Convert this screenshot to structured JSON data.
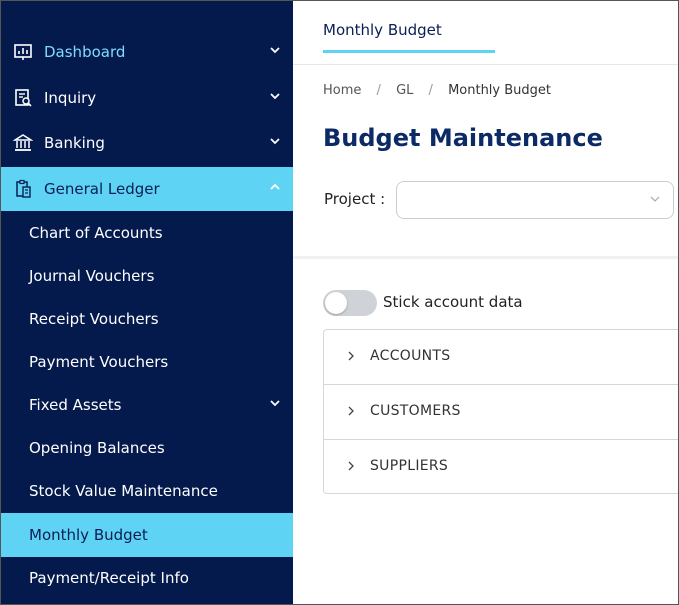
{
  "sidebar": {
    "items": [
      {
        "label": "Dashboard",
        "icon": "dashboard-chart-icon",
        "has_chevron": true
      },
      {
        "label": "Inquiry",
        "icon": "inquiry-search-icon",
        "has_chevron": true
      },
      {
        "label": "Banking",
        "icon": "bank-icon",
        "has_chevron": true
      },
      {
        "label": "General Ledger",
        "icon": "clipboard-ledger-icon",
        "expanded": true
      }
    ],
    "sub_items": [
      {
        "label": "Chart of Accounts"
      },
      {
        "label": "Journal Vouchers"
      },
      {
        "label": "Receipt Vouchers"
      },
      {
        "label": "Payment Vouchers"
      },
      {
        "label": "Fixed Assets",
        "has_chevron": true
      },
      {
        "label": "Opening Balances"
      },
      {
        "label": "Stock Value Maintenance"
      },
      {
        "label": "Monthly Budget",
        "active": true
      },
      {
        "label": "Payment/Receipt Info"
      }
    ]
  },
  "tabs": [
    {
      "label": "Monthly Budget"
    }
  ],
  "breadcrumb": {
    "home": "Home",
    "gl": "GL",
    "current": "Monthly Budget",
    "separator": "/"
  },
  "page": {
    "title": "Budget Maintenance"
  },
  "project": {
    "label": "Project :",
    "value": ""
  },
  "toggle": {
    "label": "Stick account data",
    "on": false
  },
  "accordion": [
    {
      "label": "ACCOUNTS"
    },
    {
      "label": "CUSTOMERS"
    },
    {
      "label": "SUPPLIERS"
    }
  ],
  "colors": {
    "sidebar_bg": "#041a4d",
    "accent": "#5fd3f3",
    "title": "#0b2a66"
  }
}
